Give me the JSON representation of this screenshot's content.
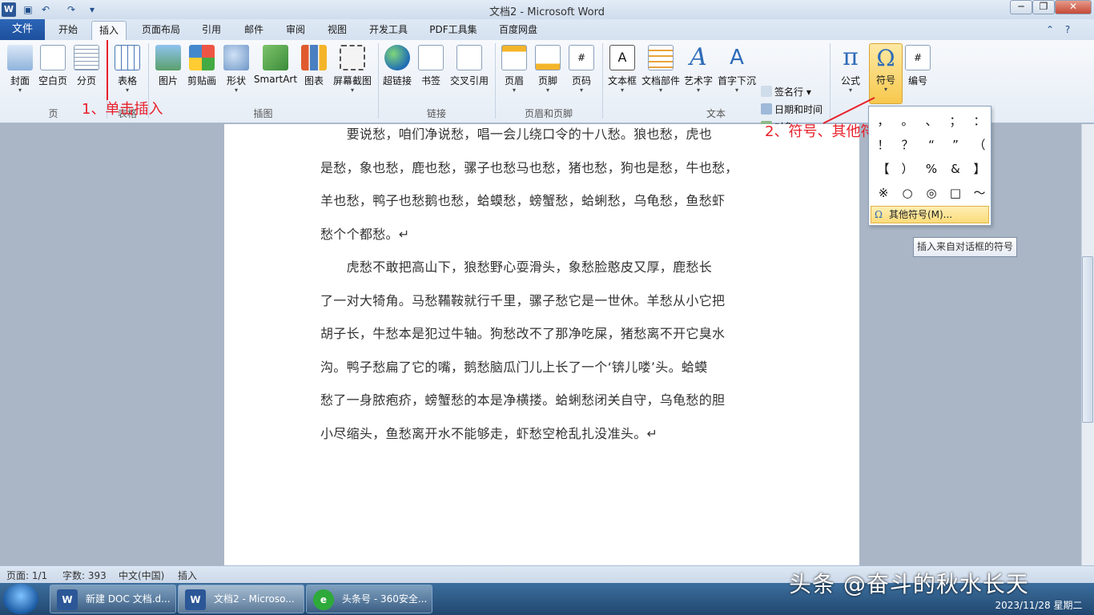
{
  "title": "文档2 - Microsoft Word",
  "window": {
    "min": "─",
    "max": "❐",
    "close": "✕"
  },
  "tabs": {
    "file": "文件",
    "items": [
      "开始",
      "插入",
      "页面布局",
      "引用",
      "邮件",
      "审阅",
      "视图",
      "开发工具",
      "PDF工具集",
      "百度网盘"
    ]
  },
  "ribbon": {
    "cover": "封面",
    "blank": "空白页",
    "break": "分页",
    "table": "表格",
    "picture": "图片",
    "clipart": "剪贴画",
    "shapes": "形状",
    "smartart": "SmartArt",
    "chart": "图表",
    "screenshot": "屏幕截图",
    "hyperlink": "超链接",
    "bookmark": "书签",
    "crossref": "交叉引用",
    "header": "页眉",
    "footer": "页脚",
    "pagenum": "页码",
    "textbox": "文本框",
    "quickparts": "文档部件",
    "wordart": "艺术字",
    "dropcap": "首字下沉",
    "signature": "签名行",
    "datetime": "日期和时间",
    "object": "对象",
    "equation": "公式",
    "symbol": "符号",
    "number": "编号",
    "groups": {
      "pages": "页",
      "tables": "表格",
      "illustrations": "插图",
      "links": "链接",
      "headerfooter": "页眉和页脚",
      "text": "文本"
    }
  },
  "annotations": {
    "a1": "1、单击插入",
    "a2": "2、符号、其他符号"
  },
  "gallery": {
    "symbols": [
      "，",
      "。",
      "、",
      "；",
      "：",
      "！",
      "？",
      "“",
      "”",
      "（",
      "【",
      "）",
      "%",
      "&",
      "】",
      "※",
      "○",
      "◎",
      "□",
      "～"
    ],
    "more": "其他符号(M)..."
  },
  "tooltip": "插入来自对话框的符号",
  "document": {
    "paragraphs": [
      [
        "　　要说愁，咱们净说愁，唱一会儿绕口令的十八愁。狼也愁，虎也",
        "是愁，象也愁，鹿也愁，骡子也愁马也愁，猪也愁，狗也是愁，牛也愁，",
        "羊也愁，鸭子也愁鹅也愁，蛤蟆愁，螃蟹愁，蛤蜊愁，乌龟愁，鱼愁虾",
        "愁个个都愁。↵"
      ],
      [
        "　　虎愁不敢把高山下，狼愁野心耍滑头，象愁脸憨皮又厚，鹿愁长",
        "了一对大犄角。马愁鞴鞍就行千里，骡子愁它是一世休。羊愁从小它把",
        "胡子长，牛愁本是犯过牛轴。狗愁改不了那净吃屎，猪愁离不开它臭水",
        "沟。鸭子愁扁了它的嘴，鹅愁脑瓜门儿上长了一个‘锛儿喽’头。蛤蟆",
        "愁了一身脓疱疥，螃蟹愁的本是净横搂。蛤蜊愁闭关自守，乌龟愁的胆",
        "小尽缩头，鱼愁离开水不能够走，虾愁空枪乱扎没准头。↵"
      ]
    ]
  },
  "status": {
    "page": "页面: 1/1",
    "words": "字数: 393",
    "lang": "中文(中国)",
    "mode": "插入"
  },
  "taskbar": {
    "items": [
      "新建 DOC 文档.d...",
      "文档2 - Microso...",
      "头条号 - 360安全..."
    ],
    "date": "2023/11/28 星期二"
  },
  "watermark": "头条 @奋斗的秋水长天"
}
